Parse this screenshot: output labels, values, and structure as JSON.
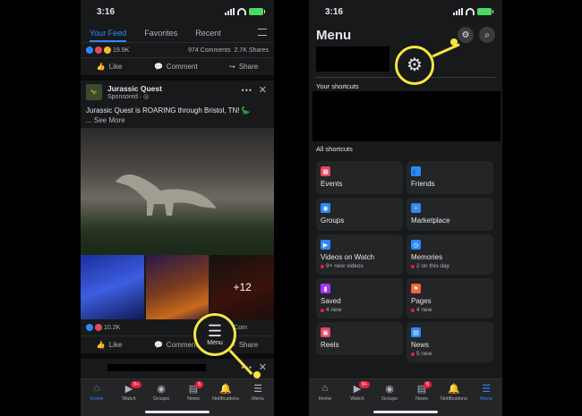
{
  "left": {
    "status_time": "3:16",
    "tabs": [
      "Your Feed",
      "Favorites",
      "Recent"
    ],
    "prev_post": {
      "reactions": "19.9K",
      "comments": "974 Comments",
      "shares": "2.7K Shares"
    },
    "actions": {
      "like": "Like",
      "comment": "Comment",
      "share": "Share"
    },
    "post": {
      "page_name": "Jurassic Quest",
      "sponsored": "Sponsored",
      "text": "Jurassic Quest is ROARING through Bristol, TN! 🦕",
      "see_more": "... See More",
      "extra_photos": "+12",
      "reactions": "10.2K",
      "comments": "2.5K Com",
      "shares": "are"
    },
    "callout_label": "Menu",
    "nav": [
      {
        "label": "Home",
        "icon": "home-icon"
      },
      {
        "label": "Watch",
        "icon": "watch-icon",
        "badge": "9+"
      },
      {
        "label": "Groups",
        "icon": "groups-icon"
      },
      {
        "label": "News",
        "icon": "news-icon",
        "badge": "5"
      },
      {
        "label": "Notifications",
        "icon": "bell-icon"
      },
      {
        "label": "Menu",
        "icon": "menu-icon"
      }
    ]
  },
  "right": {
    "status_time": "3:16",
    "title": "Menu",
    "your_shortcuts": "Your shortcuts",
    "all_shortcuts": "All shortcuts",
    "cards": [
      {
        "label": "Events",
        "sub": "",
        "icon": "events-icon",
        "color": "#e4475f"
      },
      {
        "label": "Friends",
        "sub": "",
        "icon": "friends-icon",
        "color": "#2d88ff"
      },
      {
        "label": "Groups",
        "sub": "",
        "icon": "groups-icon",
        "color": "#2d88ff"
      },
      {
        "label": "Marketplace",
        "sub": "",
        "icon": "marketplace-icon",
        "color": "#2d88ff"
      },
      {
        "label": "Videos on Watch",
        "sub": "9+ new videos",
        "icon": "video-icon",
        "color": "#2d88ff"
      },
      {
        "label": "Memories",
        "sub": "2 on this day",
        "icon": "memories-icon",
        "color": "#2d88ff"
      },
      {
        "label": "Saved",
        "sub": "4 new",
        "icon": "saved-icon",
        "color": "#a033ff"
      },
      {
        "label": "Pages",
        "sub": "4 new",
        "icon": "pages-icon",
        "color": "#f7623b"
      },
      {
        "label": "Reels",
        "sub": "",
        "icon": "reels-icon",
        "color": "#e4475f"
      },
      {
        "label": "News",
        "sub": "5 new",
        "icon": "news-icon",
        "color": "#2d88ff"
      }
    ],
    "nav": [
      {
        "label": "Home",
        "icon": "home-icon"
      },
      {
        "label": "Watch",
        "icon": "watch-icon",
        "badge": "9+"
      },
      {
        "label": "Groups",
        "icon": "groups-icon"
      },
      {
        "label": "News",
        "icon": "news-icon",
        "badge": "5"
      },
      {
        "label": "Notifications",
        "icon": "bell-icon"
      },
      {
        "label": "Menu",
        "icon": "menu-icon"
      }
    ]
  },
  "colors": {
    "accent": "#2d88ff",
    "highlight": "#f5e642",
    "badge": "#e41e3f"
  }
}
